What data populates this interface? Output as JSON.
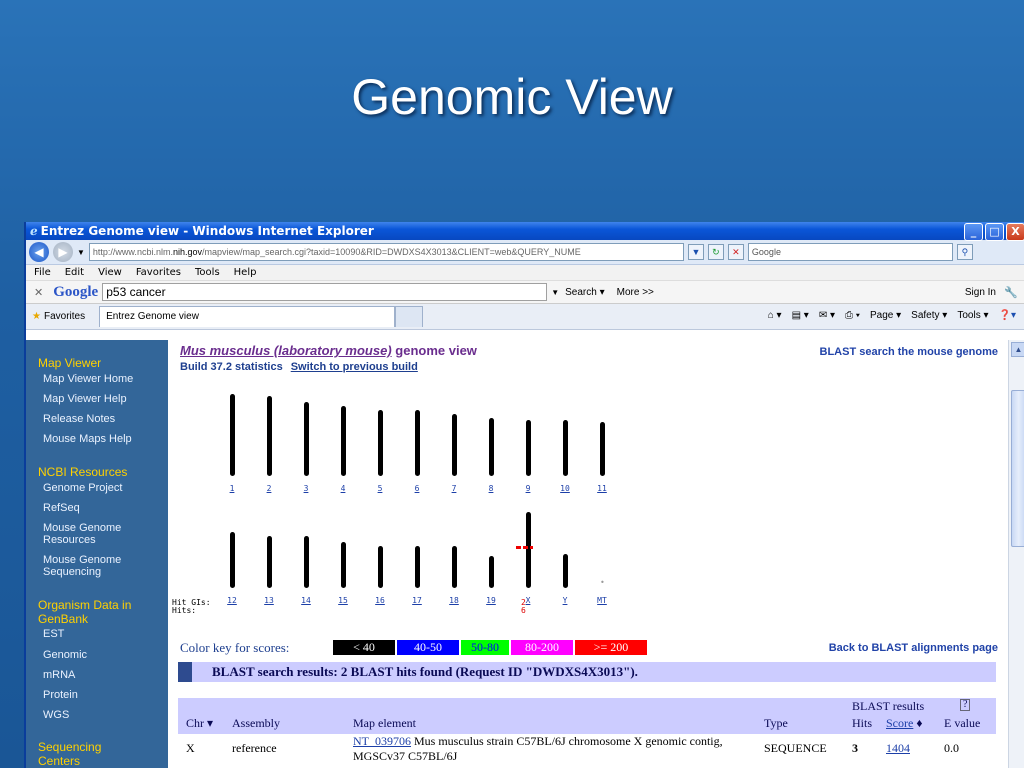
{
  "slide": {
    "title": "Genomic View"
  },
  "window": {
    "title": "Entrez Genome view - Windows Internet Explorer",
    "controls": {
      "min": "_",
      "max": "□",
      "close": "X"
    }
  },
  "address": {
    "url_prefix": "http://www.ncbi.nlm.",
    "url_domain": "nih.gov",
    "url_rest": "/mapview/map_search.cgi?taxid=10090&RID=DWDXS4X3013&CLIENT=web&QUERY_NUME",
    "search_placeholder": "Google"
  },
  "menu": [
    "File",
    "Edit",
    "View",
    "Favorites",
    "Tools",
    "Help"
  ],
  "googlebar": {
    "logo": "Google",
    "query": "p53 cancer",
    "search_label": "Search",
    "more_label": "More >>",
    "signin": "Sign In"
  },
  "favbar": {
    "favorites": "Favorites",
    "tab_label": "Entrez Genome view",
    "tools": [
      "Page",
      "Safety",
      "Tools"
    ]
  },
  "sidebar": {
    "sections": [
      {
        "title": "Map Viewer",
        "items": [
          "Map Viewer Home",
          "Map Viewer Help",
          "Release Notes",
          "Mouse Maps Help"
        ]
      },
      {
        "title": "NCBI Resources",
        "items": [
          "Genome Project",
          "RefSeq",
          "Mouse Genome Resources",
          "Mouse Genome Sequencing"
        ]
      },
      {
        "title": "Organism Data in GenBank",
        "items": [
          "EST",
          "Genomic",
          "mRNA",
          "Protein",
          "WGS"
        ]
      },
      {
        "title": "Sequencing Centers",
        "items": []
      }
    ]
  },
  "page": {
    "organism_link": "Mus musculus (laboratory mouse)",
    "title_rest": "genome view",
    "blast_link": "BLAST search the mouse genome",
    "build": "Build 37.2 statistics",
    "switch_build": "Switch to previous build",
    "chromosomes_row1": [
      "1",
      "2",
      "3",
      "4",
      "5",
      "6",
      "7",
      "8",
      "9",
      "10",
      "11"
    ],
    "chromosomes_row2": [
      "12",
      "13",
      "14",
      "15",
      "16",
      "17",
      "18",
      "19",
      "X",
      "Y",
      "MT"
    ],
    "hit_gis_label": "Hit GIs:",
    "hits_label": "Hits:",
    "hit_gis_x": "2",
    "hits_x": "6",
    "color_key_label": "Color key for scores:",
    "color_key": [
      {
        "label": "< 40",
        "color": "#000000",
        "text": "#ffffff"
      },
      {
        "label": "40-50",
        "color": "#0000ff",
        "text": "#ffffff"
      },
      {
        "label": "50-80",
        "color": "#00ff00",
        "text": "#0000ff"
      },
      {
        "label": "80-200",
        "color": "#ff00ff",
        "text": "#ffffff"
      },
      {
        "label": ">= 200",
        "color": "#ff0000",
        "text": "#ffffff"
      }
    ],
    "back_link": "Back to BLAST alignments page",
    "results_heading": "BLAST search results: 2 BLAST hits found (Request ID \"DWDXS4X3013\").",
    "table": {
      "group_header": "BLAST results",
      "help": "?",
      "headers": {
        "chr": "Chr",
        "assembly": "Assembly",
        "map_element": "Map element",
        "type": "Type",
        "hits": "Hits",
        "score": "Score",
        "evalue": "E value"
      },
      "rows": [
        {
          "chr": "X",
          "assembly": "reference",
          "accession": "NT_039706",
          "desc": "Mus musculus strain C57BL/6J chromosome X genomic contig, MGSCv37 C57BL/6J",
          "type": "SEQUENCE",
          "hits": "3",
          "score": "1404",
          "evalue": "0.0"
        }
      ]
    }
  }
}
